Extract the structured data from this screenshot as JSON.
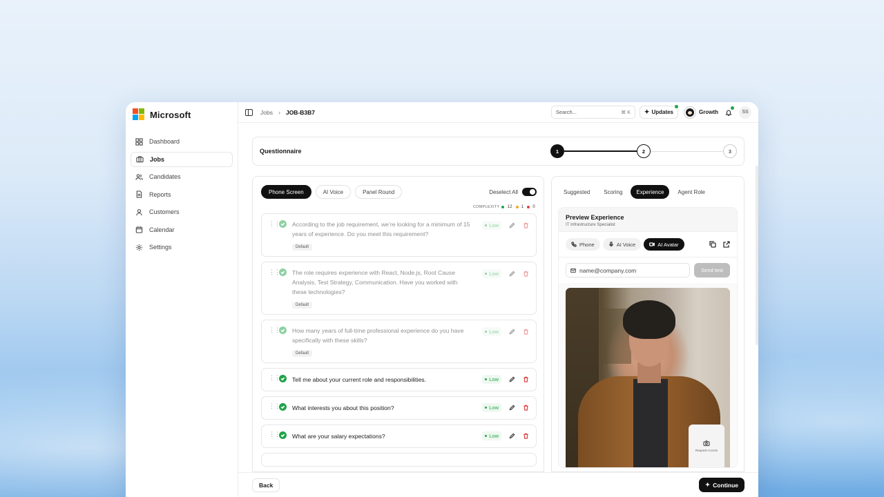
{
  "brand": {
    "name": "Microsoft",
    "logo_colors": [
      "#f25022",
      "#7fba00",
      "#00a4ef",
      "#ffb900"
    ]
  },
  "sidebar": {
    "items": [
      {
        "label": "Dashboard",
        "icon": "dashboard-icon",
        "active": false
      },
      {
        "label": "Jobs",
        "icon": "briefcase-icon",
        "active": true
      },
      {
        "label": "Candidates",
        "icon": "users-icon",
        "active": false
      },
      {
        "label": "Reports",
        "icon": "report-icon",
        "active": false
      },
      {
        "label": "Customers",
        "icon": "user-icon",
        "active": false
      },
      {
        "label": "Calendar",
        "icon": "calendar-icon",
        "active": false
      },
      {
        "label": "Settings",
        "icon": "gear-icon",
        "active": false
      }
    ]
  },
  "header": {
    "breadcrumb_root": "Jobs",
    "breadcrumb_sep": "›",
    "breadcrumb_current": "JOB-B3B7",
    "search_placeholder": "Search...",
    "search_shortcut": "⌘ K",
    "updates_label": "Updates",
    "workspace_label": "Growth",
    "user_initials": "SS"
  },
  "stepper": {
    "title": "Questionnaire",
    "steps": [
      "1",
      "2",
      "3"
    ]
  },
  "questions_panel": {
    "tabs": [
      "Phone Screen",
      "AI Voice",
      "Panel Round"
    ],
    "active_tab": "Phone Screen",
    "deselect_label": "Deselect All",
    "complexity_label": "COMPLEXITY",
    "complexity_counts": {
      "low": "12",
      "medium": "1",
      "high": "0"
    },
    "complexity_colors": {
      "low": "#22a34a",
      "medium": "#f5a623",
      "high": "#e04444"
    },
    "questions": [
      {
        "text": "According to the job requirement, we’re looking for a minimum of 15 years of experience. Do you meet this requirement?",
        "tag": "Default",
        "level": "Low"
      },
      {
        "text": "The role requires experience with React, Node.js, Root Cause Analysis, Test Strategy, Communication. Have you worked with these technologies?",
        "tag": "Default",
        "level": "Low"
      },
      {
        "text": "How many years of full-time professional experience do you have specifically with these skills?",
        "tag": "Default",
        "level": "Low"
      },
      {
        "text": "Tell me about your current role and responsibilities.",
        "tag": "",
        "level": "Low"
      },
      {
        "text": "What interests you about this position?",
        "tag": "",
        "level": "Low"
      },
      {
        "text": "What are your salary expectations?",
        "tag": "",
        "level": "Low"
      }
    ]
  },
  "preview_panel": {
    "tabs": [
      "Suggested",
      "Scoring",
      "Experience",
      "Agent Role"
    ],
    "active_tab": "Experience",
    "title": "Preview Experience",
    "subtitle": "IT Infrastructure Specialist",
    "modes": [
      "Phone",
      "AI Voice",
      "AI Avatar"
    ],
    "active_mode": "AI Avatar",
    "email_placeholder": "name@company.com",
    "send_label": "Send test",
    "camera_tile_label": "Request Access"
  },
  "footer": {
    "back_label": "Back",
    "continue_label": "Continue"
  }
}
